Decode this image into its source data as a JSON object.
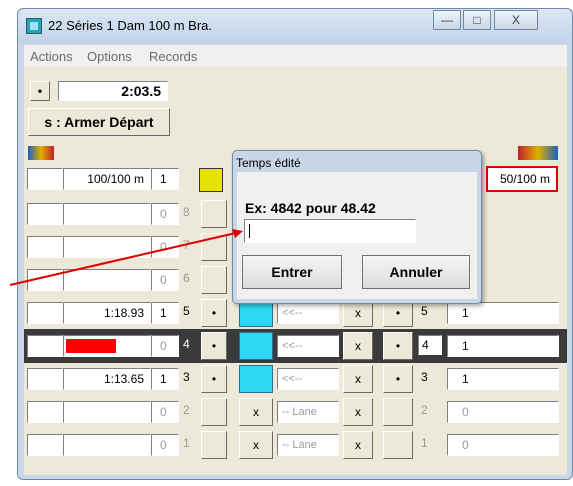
{
  "window": {
    "title": "22 Séries 1  Dam 100 m Bra.",
    "min_label": "—",
    "max_label": "□",
    "close_label": "X"
  },
  "menu": [
    "Actions",
    "Options",
    "Records"
  ],
  "timer": {
    "bullet": "•",
    "time": "2:03.5"
  },
  "start_button": "s : Armer Départ",
  "header_row": {
    "distance_left": "100/100 m",
    "lane_left": "1",
    "distance_right": "50/100 m"
  },
  "lanes": [
    {
      "lane": "8",
      "time": "",
      "rank": "0"
    },
    {
      "lane": "7",
      "time": "",
      "rank": "0"
    },
    {
      "lane": "6",
      "time": "",
      "rank": "0"
    },
    {
      "lane": "5",
      "time": "1:18.93",
      "rank": "1",
      "arrow": "<<--",
      "x": "x",
      "bullet": "•",
      "right_lane": "5",
      "right_rank": "1"
    },
    {
      "lane": "4",
      "time": "",
      "rank": "0",
      "arrow": "<<--",
      "x": "x",
      "bullet": "•",
      "right_lane": "4",
      "right_rank": "1"
    },
    {
      "lane": "3",
      "time": "1:13.65",
      "rank": "1",
      "arrow": "<<--",
      "x": "x",
      "bullet": "•",
      "right_lane": "3",
      "right_rank": "1"
    },
    {
      "lane": "2",
      "time": "",
      "rank": "0",
      "arrow": "-- Lane",
      "x": "x",
      "right_lane": "2",
      "right_rank": "0"
    },
    {
      "lane": "1",
      "time": "",
      "rank": "0",
      "arrow": "-- Lane",
      "x": "x",
      "right_lane": "1",
      "right_rank": "0"
    }
  ],
  "dialog": {
    "title": "Temps édité",
    "hint": "Ex: 4842 pour 48.42",
    "input_value": "",
    "ok": "Entrer",
    "cancel": "Annuler"
  },
  "colors": {
    "accent_red": "#ff0000",
    "button_blue": "#2fd7f2"
  }
}
